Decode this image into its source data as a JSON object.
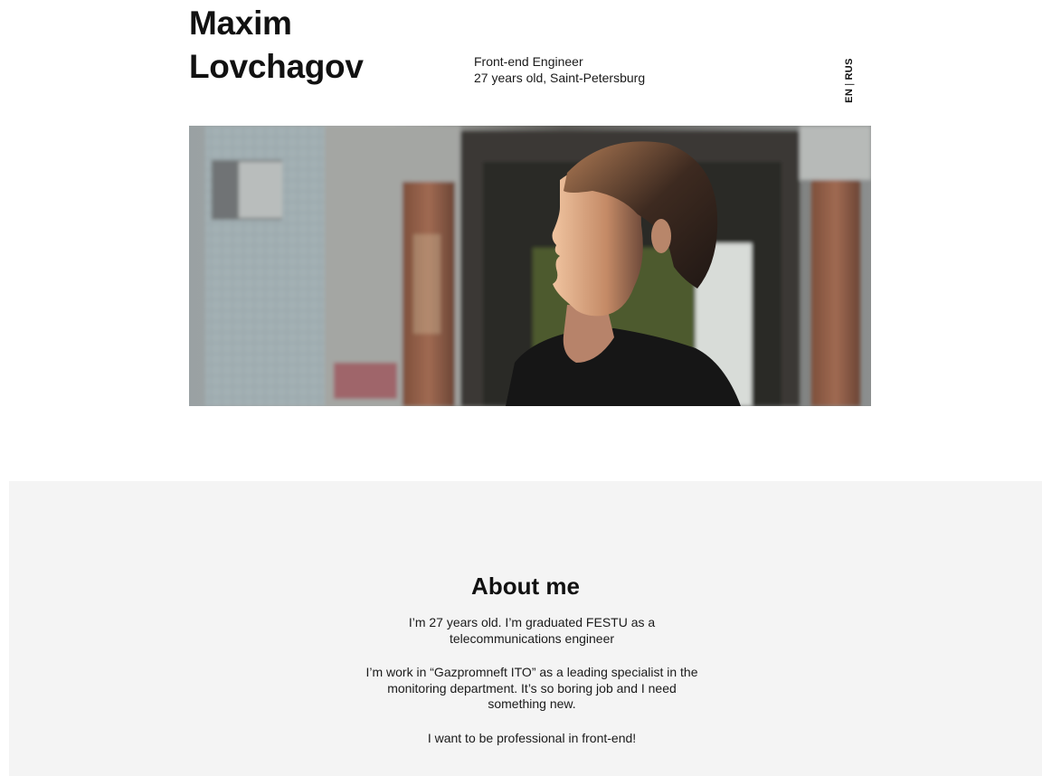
{
  "header": {
    "first_name": "Maxim",
    "last_name": "Lovchagov",
    "role": "Front-end Engineer",
    "details": "27 years old, Saint-Petersburg",
    "lang_en": "EN",
    "lang_separator": "|",
    "lang_rus": "RUS"
  },
  "photo": {
    "subject": "portrait photo of a man in a black t-shirt in front of a concrete building"
  },
  "about": {
    "title": "About me",
    "paragraphs": [
      "I’m 27 years old. I’m graduated FESTU as a telecommunications engineer",
      "I’m work in “Gazpromneft ITO” as a leading specialist in the monitoring department. It’s so boring job and I need something new.",
      "I want to be professional in front-end!"
    ]
  },
  "colors": {
    "text": "#111111",
    "background": "#ffffff",
    "section_background": "#f4f4f4"
  }
}
